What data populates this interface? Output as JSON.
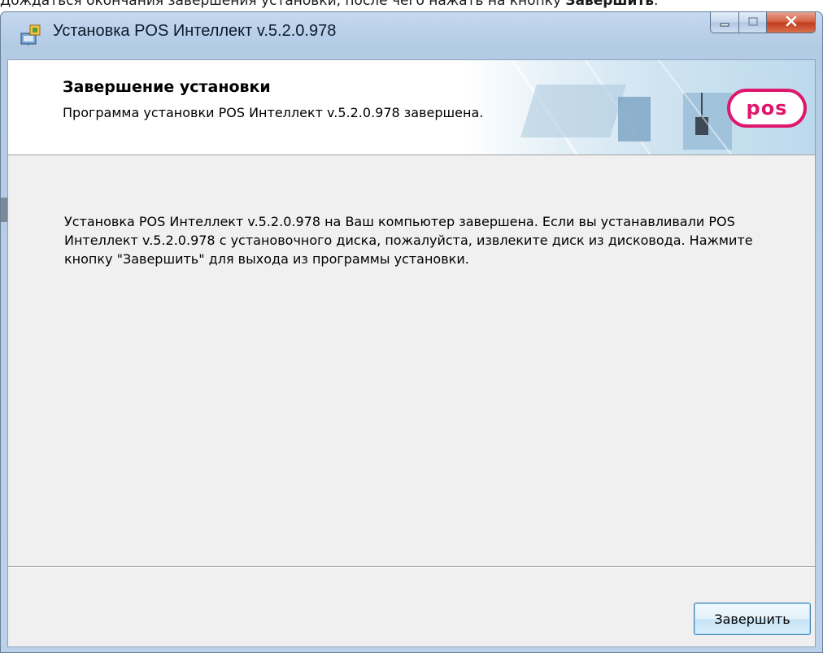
{
  "caption": {
    "text": "Дождаться окончания завершения установки, после чего нажать на кнопку ",
    "bold": "Завершить",
    "tail": "."
  },
  "window": {
    "title": "Установка POS Интеллект v.5.2.0.978"
  },
  "header": {
    "title": "Завершение установки",
    "subtitle": "Программа установки POS Интеллект v.5.2.0.978 завершена.",
    "logo_text": "pos"
  },
  "body": {
    "message": "Установка POS Интеллект v.5.2.0.978 на Ваш компьютер завершена. Если вы устанавливали POS Интеллект v.5.2.0.978 с установочного диска, пожалуйста, извлеките диск из дисковода. Нажмите кнопку \"Завершить\" для выхода из программы установки."
  },
  "buttons": {
    "finish_label": "Завершить"
  },
  "colors": {
    "accent_logo": "#e0166e",
    "close_button": "#c23a1c"
  },
  "icons": [
    "installer-icon",
    "minimize-icon",
    "maximize-icon",
    "close-icon"
  ]
}
